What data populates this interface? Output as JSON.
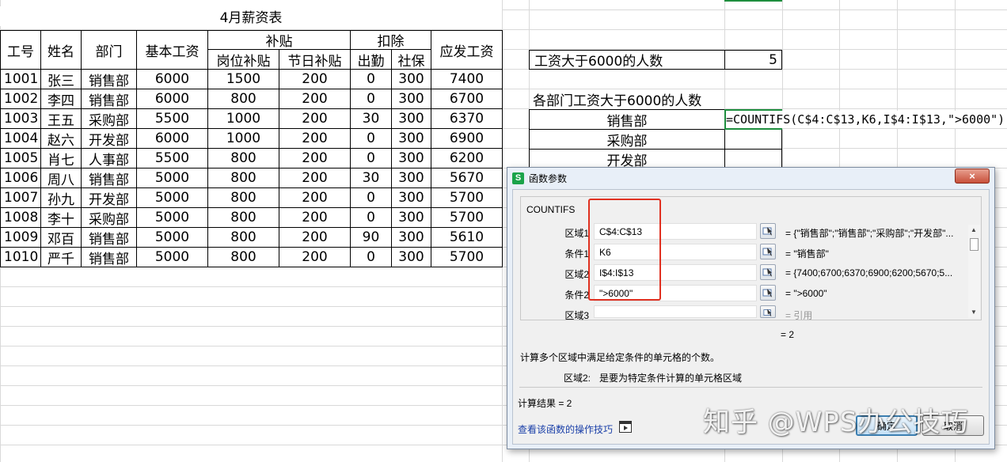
{
  "sheet": {
    "title": "4月薪资表",
    "headers": {
      "id": "工号",
      "name": "姓名",
      "dept": "部门",
      "base": "基本工资",
      "subsidy": "补贴",
      "post_subsidy": "岗位补贴",
      "holiday_subsidy": "节日补贴",
      "deduction": "扣除",
      "attendance": "出勤",
      "social": "社保",
      "payable": "应发工资"
    },
    "rows": [
      [
        "1001",
        "张三",
        "销售部",
        "6000",
        "1500",
        "200",
        "0",
        "300",
        "7400"
      ],
      [
        "1002",
        "李四",
        "销售部",
        "6000",
        "800",
        "200",
        "0",
        "300",
        "6700"
      ],
      [
        "1003",
        "王五",
        "采购部",
        "5500",
        "1000",
        "200",
        "30",
        "300",
        "6370"
      ],
      [
        "1004",
        "赵六",
        "开发部",
        "6000",
        "1000",
        "200",
        "0",
        "300",
        "6900"
      ],
      [
        "1005",
        "肖七",
        "人事部",
        "5500",
        "800",
        "200",
        "0",
        "300",
        "6200"
      ],
      [
        "1006",
        "周八",
        "销售部",
        "5000",
        "800",
        "200",
        "30",
        "300",
        "5670"
      ],
      [
        "1007",
        "孙九",
        "开发部",
        "5000",
        "800",
        "200",
        "0",
        "300",
        "5700"
      ],
      [
        "1008",
        "李十",
        "采购部",
        "5000",
        "800",
        "200",
        "0",
        "300",
        "5700"
      ],
      [
        "1009",
        "邓百",
        "销售部",
        "5000",
        "800",
        "200",
        "90",
        "300",
        "5610"
      ],
      [
        "1010",
        "严千",
        "销售部",
        "5000",
        "800",
        "200",
        "0",
        "300",
        "5700"
      ]
    ]
  },
  "summary": {
    "over6000_label": "工资大于6000的人数",
    "over6000_value": "5",
    "by_dept_label": "各部门工资大于6000的人数",
    "depts": [
      "销售部",
      "采购部",
      "开发部"
    ],
    "formula": "=COUNTIFS(C$4:C$13,K6,I$4:I$13,\">6000\")"
  },
  "dialog": {
    "logo": "S",
    "title": "函数参数",
    "close": "×",
    "func_name": "COUNTIFS",
    "args": [
      {
        "label": "区域1",
        "value": "C$4:C$13",
        "result": "= {\"销售部\";\"销售部\";\"采购部\";\"开发部\"..."
      },
      {
        "label": "条件1",
        "value": "K6",
        "result": "= \"销售部\""
      },
      {
        "label": "区域2",
        "value": "I$4:I$13",
        "result": "= {7400;6700;6370;6900;6200;5670;5..."
      },
      {
        "label": "条件2",
        "value": "\">6000\"",
        "result": "= \">6000\""
      },
      {
        "label": "区域3",
        "value": "",
        "result": "= 引用"
      }
    ],
    "eval_result": "= 2",
    "description": "计算多个区域中满足给定条件的单元格的个数。",
    "param_name": "区域2:",
    "param_desc": "是要为特定条件计算的单元格区域",
    "calc_result": "计算结果 =  2",
    "help_link": "查看该函数的操作技巧",
    "ok": "确定",
    "cancel": "取消"
  },
  "watermark": "知乎 @WPS办公技巧"
}
